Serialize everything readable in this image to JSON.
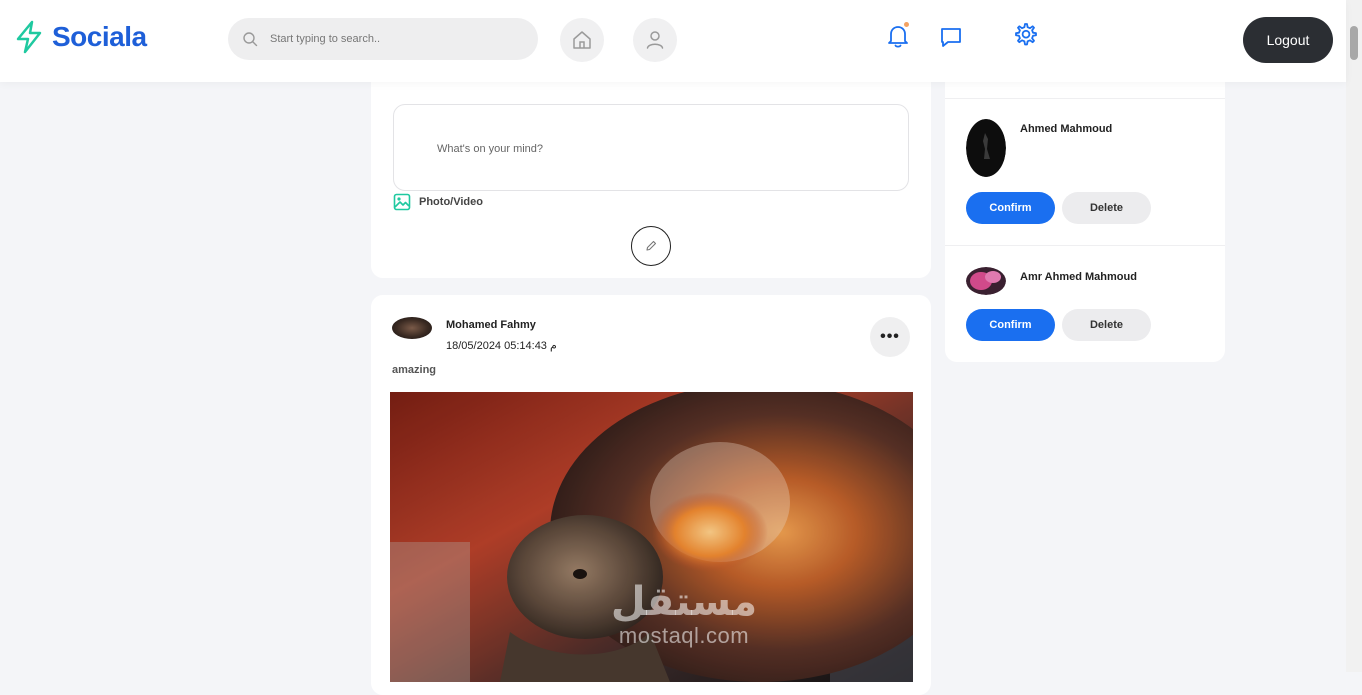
{
  "app": {
    "name": "Sociala",
    "brand_color": "#1e5fd8",
    "logo_icon_color": "#1fc9a0"
  },
  "header": {
    "search_placeholder": "Start typing to search..",
    "logout_label": "Logout",
    "nav_icons": [
      "home-icon",
      "user-icon"
    ],
    "action_icons": [
      "bell-icon",
      "chat-icon",
      "gear-icon"
    ],
    "notification_dot_color": "#f4a261"
  },
  "create_post": {
    "placeholder": "What's on your mind?",
    "photo_video_label": "Photo/Video"
  },
  "post": {
    "author": "Mohamed Fahmy",
    "date": "18/05/2024 05:14:43 م",
    "text": "amazing",
    "more_label": "•••"
  },
  "friend_requests": [
    {
      "name": "Ahmed Mahmoud",
      "confirm_label": "Confirm",
      "delete_label": "Delete"
    },
    {
      "name": "Amr Ahmed Mahmoud",
      "confirm_label": "Confirm",
      "delete_label": "Delete"
    }
  ],
  "watermark": {
    "arabic": "مستقل",
    "latin": "mostaql.com"
  },
  "colors": {
    "confirm": "#1a6ff0",
    "delete": "#ececee",
    "logout": "#2b2e33",
    "page_background": "#f4f5f8"
  }
}
